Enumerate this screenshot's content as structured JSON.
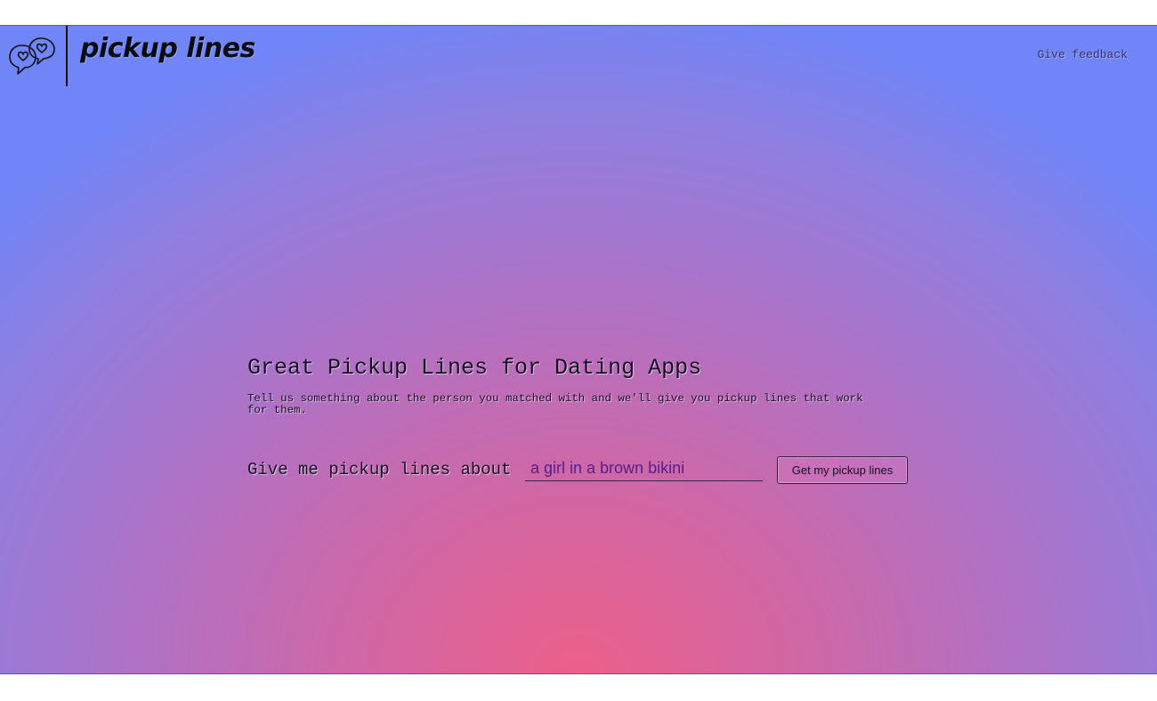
{
  "header": {
    "logo_icon": "chat-bubbles-heart-icon",
    "brand": "pickup lines",
    "feedback_link": "Give feedback"
  },
  "hero": {
    "title": "Great Pickup Lines for Dating Apps",
    "description": "Tell us something about the person you matched with and we'll give you pickup lines that work for them."
  },
  "form": {
    "label": "Give me pickup lines about",
    "input_value": "a girl in a brown bikini",
    "submit_label": "Get my pickup lines"
  },
  "colors": {
    "gradient_top": "#6f85f8",
    "gradient_bottom": "#ec6089",
    "text": "#150d24",
    "input_text": "#5a1d86"
  }
}
